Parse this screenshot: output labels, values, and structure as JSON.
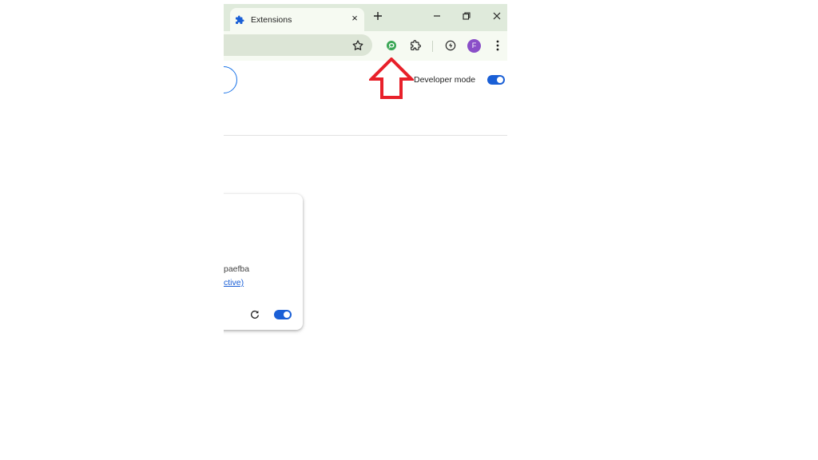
{
  "tab": {
    "title": "Extensions",
    "close_glyph": "×"
  },
  "toolbar": {
    "avatar_letter": "F"
  },
  "header": {
    "developer_mode_label": "Developer mode",
    "developer_mode_on": true
  },
  "card": {
    "id_fragment": "paefba",
    "link_fragment": "ctive)",
    "enabled": true
  },
  "colors": {
    "accent": "#1a5fd6",
    "tabstrip": "#dfeadb",
    "toolbar": "#f6faf2",
    "avatar": "#8a4fc8",
    "annotation": "#e8202a"
  },
  "icons": {
    "tab": "puzzle-icon",
    "new_tab": "plus-icon",
    "minimize": "minimize-icon",
    "restore": "restore-icon",
    "close": "close-icon",
    "bookmark": "star-icon",
    "extension_chat": "chat-bubble-icon",
    "extensions_menu": "puzzle-outline-icon",
    "performance": "leaf-icon",
    "menu": "kebab-menu-icon",
    "reload": "reload-icon"
  }
}
